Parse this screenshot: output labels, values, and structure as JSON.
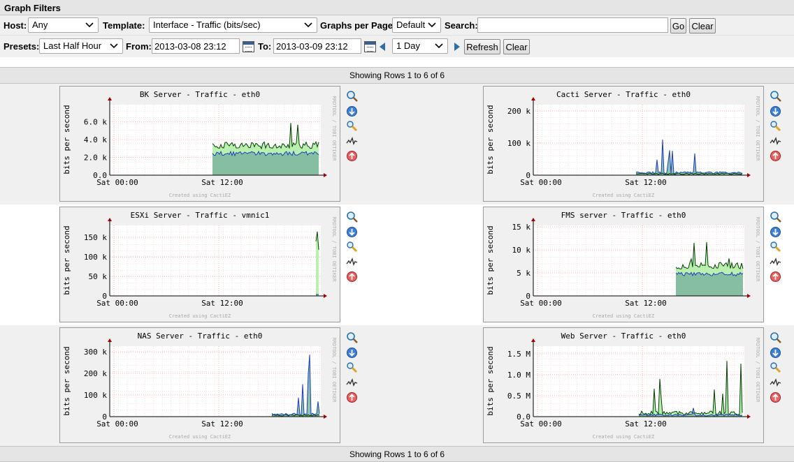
{
  "filters": {
    "title": "Graph Filters",
    "host_label": "Host:",
    "host_value": "Any",
    "template_label": "Template:",
    "template_value": "Interface - Traffic (bits/sec)",
    "gpp_label": "Graphs per Page:",
    "gpp_value": "Default",
    "search_label": "Search:",
    "search_value": "",
    "go_label": "Go",
    "clear_label": "Clear",
    "presets_label": "Presets:",
    "presets_value": "Last Half Hour",
    "from_label": "From:",
    "from_value": "2013-03-08 23:12",
    "to_label": "To:",
    "to_value": "2013-03-09 23:12",
    "span_value": "1 Day",
    "refresh_label": "Refresh",
    "clear2_label": "Clear"
  },
  "pager": {
    "top": "Showing Rows 1 to 6 of 6",
    "bottom": "Showing Rows 1 to 6 of 6"
  },
  "common": {
    "ylabel": "bits per second",
    "watermark": "RRDTOOL / TOBI OETIKER",
    "created": "Created using CactiEZ",
    "xticks": [
      "Sat 00:00",
      "Sat 12:00"
    ]
  },
  "colors": {
    "inbound": "#b9f0b0",
    "outbound": "#1a3fbf",
    "inbound_line": "#004000",
    "overlap": "#7bb59e",
    "grid": "#ff9a9a",
    "canvas": "#ffffff",
    "frame": "#f0f0f0",
    "row_alt": "#f0f0f0"
  },
  "graphs": [
    {
      "title": "BK Server - Traffic - eth0",
      "yticks": [
        "0.0",
        "2.0 k",
        "4.0 k",
        "6.0 k"
      ],
      "ymax": 8000,
      "style": "steady"
    },
    {
      "title": "Cacti Server - Traffic - eth0",
      "yticks": [
        "0",
        "100 k",
        "200 k"
      ],
      "ymax": 220000,
      "style": "spiky"
    },
    {
      "title": "ESXi Server - Traffic - vmnic1",
      "yticks": [
        "0",
        "50 k",
        "100 k",
        "150 k"
      ],
      "ymax": 190000,
      "style": "late"
    },
    {
      "title": "FMS server - Traffic - eth0",
      "yticks": [
        "0",
        "5 k",
        "10 k",
        "15 k"
      ],
      "ymax": 16000,
      "style": "steady"
    },
    {
      "title": "NAS Server - Traffic - eth0",
      "yticks": [
        "0",
        "100 k",
        "200 k",
        "300 k"
      ],
      "ymax": 330000,
      "style": "spiky"
    },
    {
      "title": "Web Server - Traffic - eth0",
      "yticks": [
        "0.0",
        "0.5 M",
        "1.0 M",
        "1.5 M"
      ],
      "ymax": 1750000,
      "style": "bursty"
    }
  ],
  "actions": [
    "zoom-icon",
    "download-icon",
    "edit-icon",
    "realtime-icon",
    "top-icon"
  ]
}
